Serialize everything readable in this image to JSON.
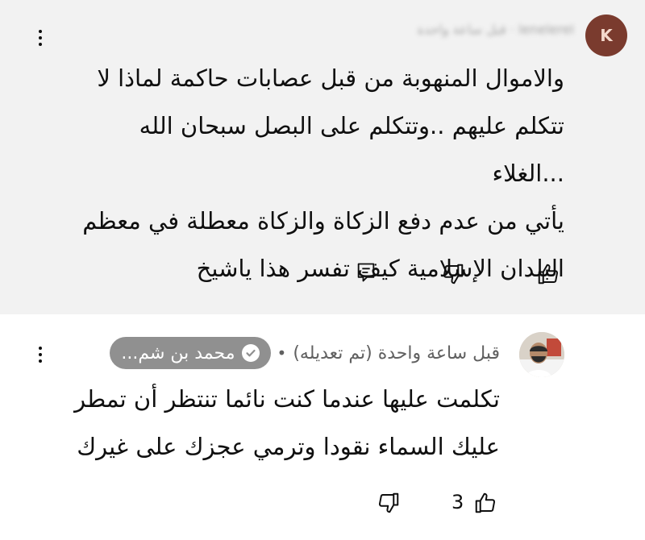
{
  "comment1": {
    "avatar_letter": "K",
    "author_blurred": "lenelerel · قبل ساعة واحدة",
    "lines": [
      "والاموال المنهوبة من قبل عصابات حاكمة لماذا لا",
      "تتكلم عليهم ..وتتكلم على البصل سبحان الله ...الغلاء",
      "يأتي من عدم دفع الزكاة والزكاة معطلة في معظم",
      "البلدان الإسلامية كيف تفسر هذا ياشيخ"
    ],
    "icons": {
      "like": "thumbs-up-icon",
      "dislike": "thumbs-down-icon",
      "reply": "reply-icon",
      "menu": "more-vert-icon"
    }
  },
  "comment2": {
    "author": "محمد بن شم...",
    "separator": "•",
    "time": "قبل ساعة واحدة (تم تعديله)",
    "lines": [
      "تكلمت عليها عندما كنت نائما تنتظر أن تمطر",
      "عليك السماء نقودا وترمي عجزك على غيرك"
    ],
    "like_count": "3",
    "icons": {
      "like": "thumbs-up-icon",
      "dislike": "thumbs-down-icon",
      "verified": "verified-check-icon",
      "menu": "more-vert-icon"
    }
  },
  "colors": {
    "highlight_bg": "#f2f2f2",
    "chip_bg": "#909090",
    "text": "#0f0f0f",
    "meta": "#606060"
  }
}
